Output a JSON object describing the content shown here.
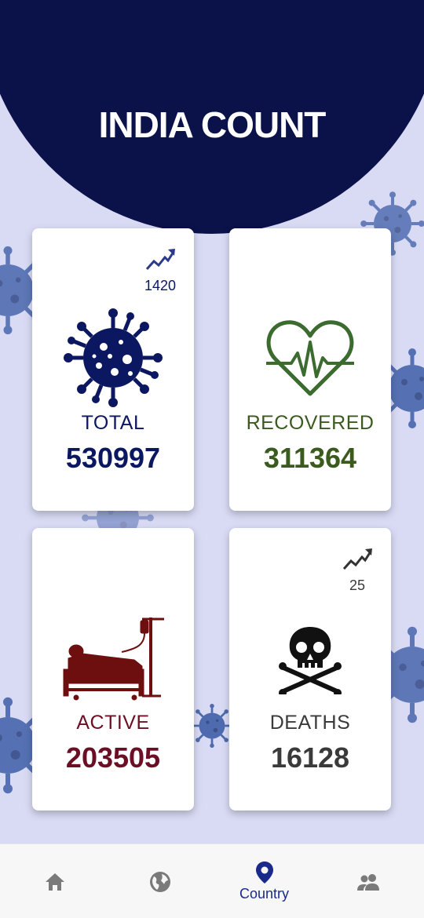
{
  "header": {
    "title": "INDIA COUNT"
  },
  "cards": {
    "total": {
      "label": "TOTAL",
      "value": "530997",
      "trend_count": "1420",
      "color": "#0b1760"
    },
    "recovered": {
      "label": "RECOVERED",
      "value": "311364",
      "color": "#3a5a1e"
    },
    "active": {
      "label": "ACTIVE",
      "value": "203505",
      "color": "#6b0f24"
    },
    "deaths": {
      "label": "DEATHS",
      "value": "16128",
      "trend_count": "25",
      "color": "#3a3a3a"
    }
  },
  "nav": {
    "items": [
      {
        "icon": "home-icon",
        "label": ""
      },
      {
        "icon": "globe-icon",
        "label": ""
      },
      {
        "icon": "location-pin-icon",
        "label": "Country"
      },
      {
        "icon": "people-icon",
        "label": ""
      }
    ],
    "active_color": "#1a2a8a",
    "inactive_color": "#7a7a7a"
  },
  "colors": {
    "header_bg": "#0b1149",
    "page_bg": "#d9dbf5"
  }
}
